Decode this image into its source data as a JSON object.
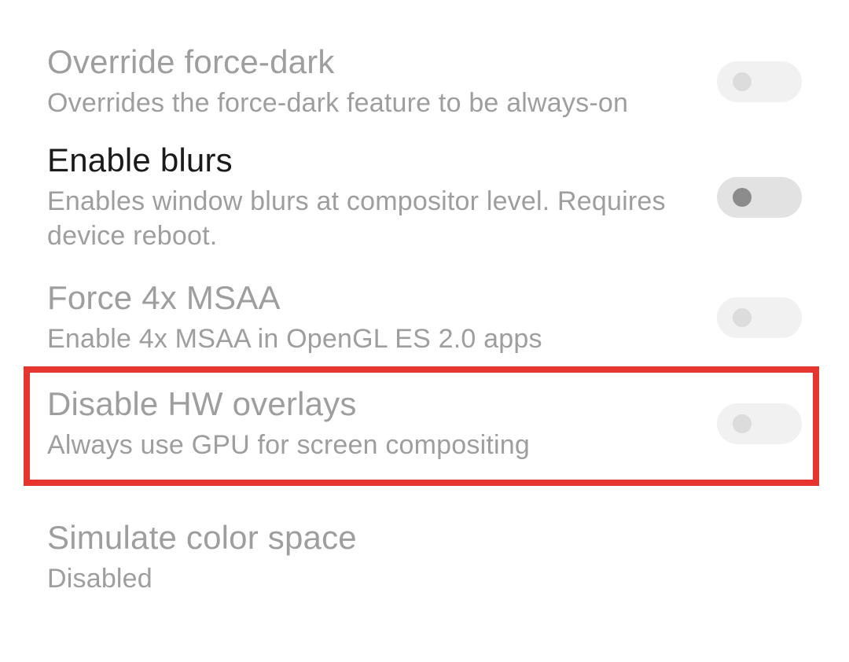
{
  "settings": [
    {
      "key": "override-force-dark",
      "title": "Override force-dark",
      "subtitle": "Overrides the force-dark feature to be always-on",
      "enabled_focus": false,
      "has_toggle": true,
      "toggle_on": false
    },
    {
      "key": "enable-blurs",
      "title": "Enable blurs",
      "subtitle": "Enables window blurs at compositor level. Requires device reboot.",
      "enabled_focus": true,
      "has_toggle": true,
      "toggle_on": false
    },
    {
      "key": "force-4x-msaa",
      "title": "Force 4x MSAA",
      "subtitle": "Enable 4x MSAA in OpenGL ES 2.0 apps",
      "enabled_focus": false,
      "has_toggle": true,
      "toggle_on": false
    },
    {
      "key": "disable-hw-overlays",
      "title": "Disable HW overlays",
      "subtitle": "Always use GPU for screen compositing",
      "enabled_focus": false,
      "has_toggle": true,
      "toggle_on": false
    },
    {
      "key": "simulate-color-space",
      "title": "Simulate color space",
      "subtitle": "Disabled",
      "enabled_focus": false,
      "has_toggle": false,
      "toggle_on": false
    }
  ],
  "highlight": {
    "target_key": "disable-hw-overlays",
    "color": "#e6352e"
  }
}
